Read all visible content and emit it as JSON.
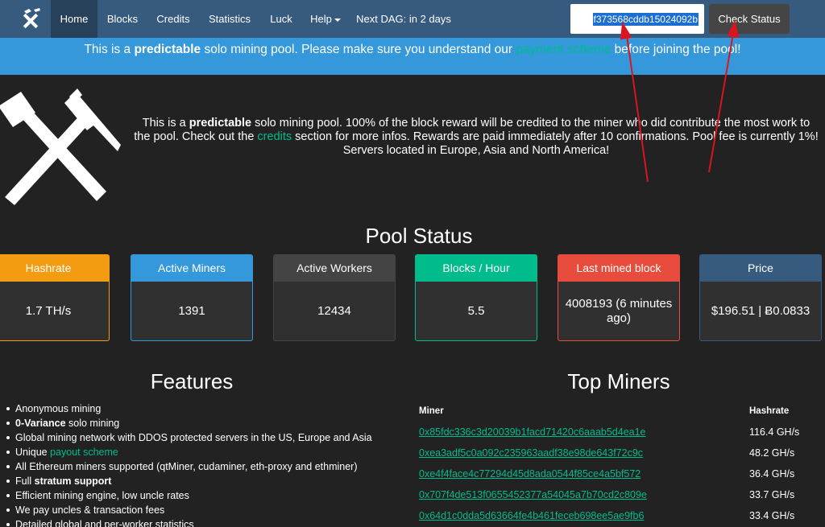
{
  "nav": {
    "items": [
      {
        "label": "Home"
      },
      {
        "label": "Blocks"
      },
      {
        "label": "Credits"
      },
      {
        "label": "Statistics"
      },
      {
        "label": "Luck"
      },
      {
        "label": "Help"
      },
      {
        "label": "Next DAG: in 2 days"
      }
    ],
    "search_value": "f373568cddb15024092b",
    "check_label": "Check Status"
  },
  "banner": {
    "pre": "This is a ",
    "bold": "predictable",
    "mid": " solo mining pool. Please make sure you understand our ",
    "link": "payment scheme",
    "post": " before joining the pool!"
  },
  "intro": {
    "pre": "This is a ",
    "bold": "predictable",
    "mid": " solo mining pool. 100% of the block reward will be credited to the miner who did contribute the most work to the pool. Check out the ",
    "link": "credits",
    "post": " section for more infos. Rewards are paid immediately after 10 confirmations. Pool fee is currently 1%! Servers located in Europe, Asia and North America!"
  },
  "pool_status": {
    "title": "Pool Status",
    "panels": [
      {
        "label": "Hashrate",
        "value": "1.7 TH/s",
        "color": "#f39c12"
      },
      {
        "label": "Active Miners",
        "value": "1391",
        "color": "#3498db"
      },
      {
        "label": "Active Workers",
        "value": "12434",
        "color": "#444444"
      },
      {
        "label": "Blocks / Hour",
        "value": "5.5",
        "color": "#00bc8c"
      },
      {
        "label": "Last mined block",
        "value": "4008193 (6 minutes ago)",
        "color": "#e74c3c"
      },
      {
        "label": "Price",
        "value": "$196.51 | Ƀ0.0833",
        "color": "#375a7f"
      }
    ]
  },
  "features": {
    "title": "Features",
    "items": [
      {
        "pre": "Anonymous mining",
        "bold": "",
        "link": "",
        "post": ""
      },
      {
        "pre": "",
        "bold": "0-Variance",
        "link": "",
        "post": " solo mining"
      },
      {
        "pre": "Global mining network with DDOS protected servers in the US, Europe and Asia",
        "bold": "",
        "link": "",
        "post": ""
      },
      {
        "pre": "Unique ",
        "bold": "",
        "link": "payout scheme",
        "post": ""
      },
      {
        "pre": "All Ethereum miners supported (qtMiner, cudaminer, eth-proxy and ethminer)",
        "bold": "",
        "link": "",
        "post": ""
      },
      {
        "pre": "Full ",
        "bold": "stratum support",
        "link": "",
        "post": ""
      },
      {
        "pre": "Efficient mining engine, low uncle rates",
        "bold": "",
        "link": "",
        "post": ""
      },
      {
        "pre": "We pay uncles & transaction fees",
        "bold": "",
        "link": "",
        "post": ""
      },
      {
        "pre": "Detailed global and per-worker statistics",
        "bold": "",
        "link": "",
        "post": ""
      }
    ]
  },
  "top_miners": {
    "title": "Top Miners",
    "col_miner": "Miner",
    "col_hashrate": "Hashrate",
    "rows": [
      {
        "miner": "0x85fdc336c3d20039b1facd71420c6aaab5d4ea1e",
        "hashrate": "116.4 GH/s"
      },
      {
        "miner": "0xea3adf5c0a092c235963aadf38e98de643f72c9c",
        "hashrate": "48.2 GH/s"
      },
      {
        "miner": "0xe4f4face4c77294d45d8ada0544f85ce4a5bf572",
        "hashrate": "36.4 GH/s"
      },
      {
        "miner": "0x707f4de513f0655452377a54045a7b70cd2c809e",
        "hashrate": "33.7 GH/s"
      },
      {
        "miner": "0x64d1c0dda5d63664fe4b461feceb698ee5ae9fb6",
        "hashrate": "33.4 GH/s"
      }
    ]
  },
  "colors": {
    "nav_bg": "#375a7f",
    "banner_bg": "#3498db",
    "page_bg": "#222222",
    "link_green": "#00bc8c"
  }
}
